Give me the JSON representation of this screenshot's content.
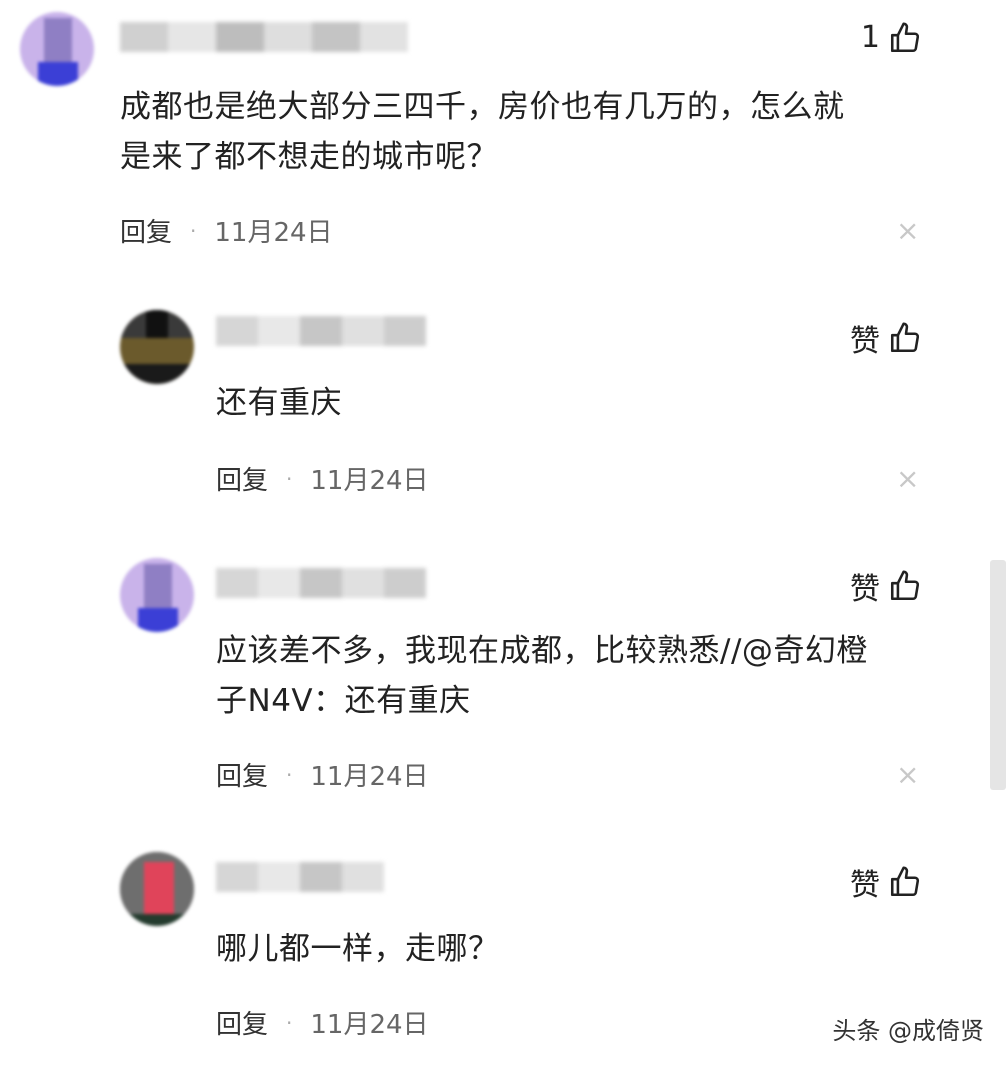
{
  "comments": [
    {
      "likes": "1",
      "text_line1": "成都也是绝大部分三四千，房价也有几万的，怎么就",
      "text_line2": "是来了都不想走的城市呢？",
      "reply_label": "回复",
      "date": "11月24日"
    },
    {
      "likes": "赞",
      "text_line1": "还有重庆",
      "reply_label": "回复",
      "date": "11月24日"
    },
    {
      "likes": "赞",
      "text_line1": "应该差不多，我现在成都，比较熟悉//@奇幻橙",
      "text_line2": "子N4V：还有重庆",
      "reply_label": "回复",
      "date": "11月24日"
    },
    {
      "likes": "赞",
      "text_line1": "哪儿都一样，走哪？",
      "reply_label": "回复",
      "date": "11月24日"
    }
  ],
  "separator": "·",
  "close_glyph": "×",
  "watermark": "头条 @成倚贤",
  "icons": {
    "like": "thumbs-up-icon",
    "close": "close-icon"
  }
}
